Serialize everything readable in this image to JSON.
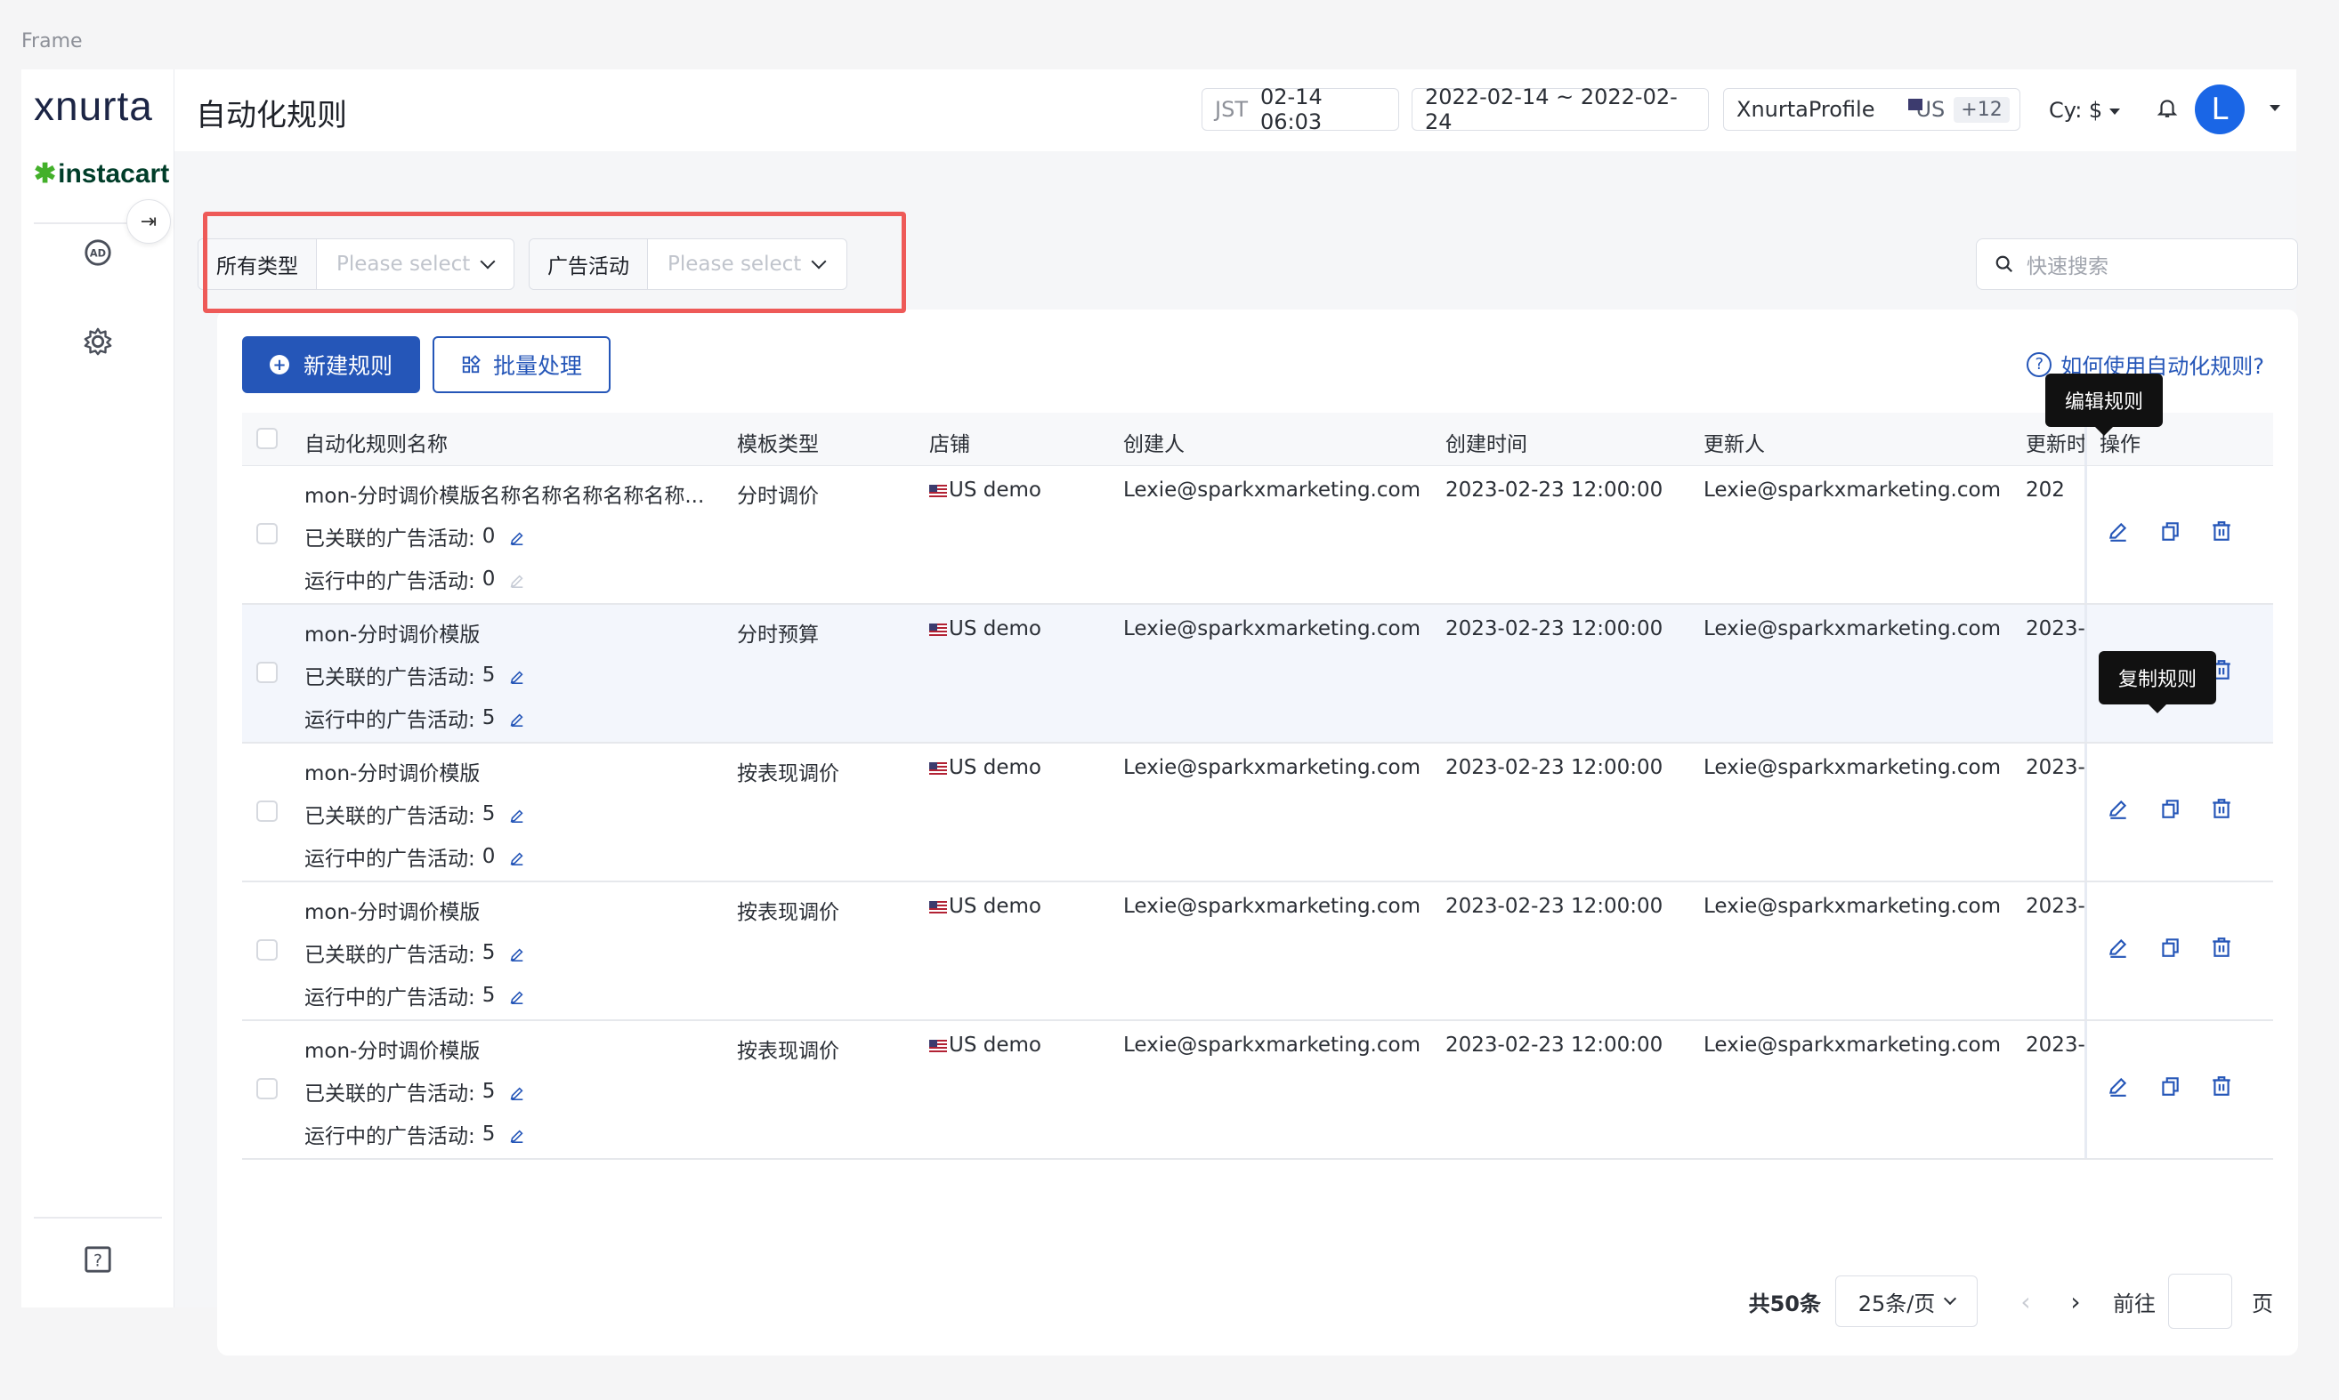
{
  "frame_label": "Frame",
  "sidebar": {
    "logo": "xnurta",
    "partner_logo": "instacart",
    "collapse_icon": "collapse-arrow-icon",
    "nav": [
      "ad-icon",
      "gear-icon"
    ],
    "bottom": "help-icon"
  },
  "header": {
    "title": "自动化规则",
    "timezone_label": "JST",
    "timezone_value": "02-14 06:03",
    "date_range": "2022-02-14 ~ 2022-02-24",
    "profile": "XnurtaProfile",
    "country": "US",
    "more_count": "+12",
    "currency": "Cy: $",
    "avatar_letter": "L"
  },
  "filters": {
    "type_label": "所有类型",
    "type_placeholder": "Please select",
    "campaign_label": "广告活动",
    "campaign_placeholder": "Please select",
    "search_placeholder": "快速搜索"
  },
  "toolbar": {
    "new_rule": "新建规则",
    "batch": "批量处理",
    "help": "如何使用自动化规则?"
  },
  "table": {
    "columns": [
      "自动化规则名称",
      "模板类型",
      "店铺",
      "创建人",
      "创建时间",
      "更新人",
      "更新时",
      "操作"
    ],
    "linked_label": "已关联的广告活动:",
    "running_label": "运行中的广告活动:",
    "rows": [
      {
        "name": "mon-分时调价模版名称名称名称名称名称...",
        "linked": "0",
        "running": "0",
        "type": "分时调价",
        "store": "US demo",
        "creator": "Lexie@sparkxmarketing.com",
        "created": "2023-02-23 12:00:00",
        "updater": "Lexie@sparkxmarketing.com",
        "updated": "202"
      },
      {
        "name": "mon-分时调价模版",
        "linked": "5",
        "running": "5",
        "type": "分时预算",
        "store": "US demo",
        "creator": "Lexie@sparkxmarketing.com",
        "created": "2023-02-23 12:00:00",
        "updater": "Lexie@sparkxmarketing.com",
        "updated": "2023-"
      },
      {
        "name": "mon-分时调价模版",
        "linked": "5",
        "running": "0",
        "type": "按表现调价",
        "store": "US demo",
        "creator": "Lexie@sparkxmarketing.com",
        "created": "2023-02-23 12:00:00",
        "updater": "Lexie@sparkxmarketing.com",
        "updated": "2023-"
      },
      {
        "name": "mon-分时调价模版",
        "linked": "5",
        "running": "5",
        "type": "按表现调价",
        "store": "US demo",
        "creator": "Lexie@sparkxmarketing.com",
        "created": "2023-02-23 12:00:00",
        "updater": "Lexie@sparkxmarketing.com",
        "updated": "2023-"
      },
      {
        "name": "mon-分时调价模版",
        "linked": "5",
        "running": "5",
        "type": "按表现调价",
        "store": "US demo",
        "creator": "Lexie@sparkxmarketing.com",
        "created": "2023-02-23 12:00:00",
        "updater": "Lexie@sparkxmarketing.com",
        "updated": "2023-"
      }
    ]
  },
  "tooltips": {
    "edit": "编辑规则",
    "copy": "复制规则"
  },
  "pagination": {
    "total": "共50条",
    "per_page": "25条/页",
    "goto": "前往",
    "page_suffix": "页"
  },
  "colors": {
    "primary": "#2556b8",
    "highlight_border": "#ee5a58",
    "avatar": "#1a66e6"
  }
}
